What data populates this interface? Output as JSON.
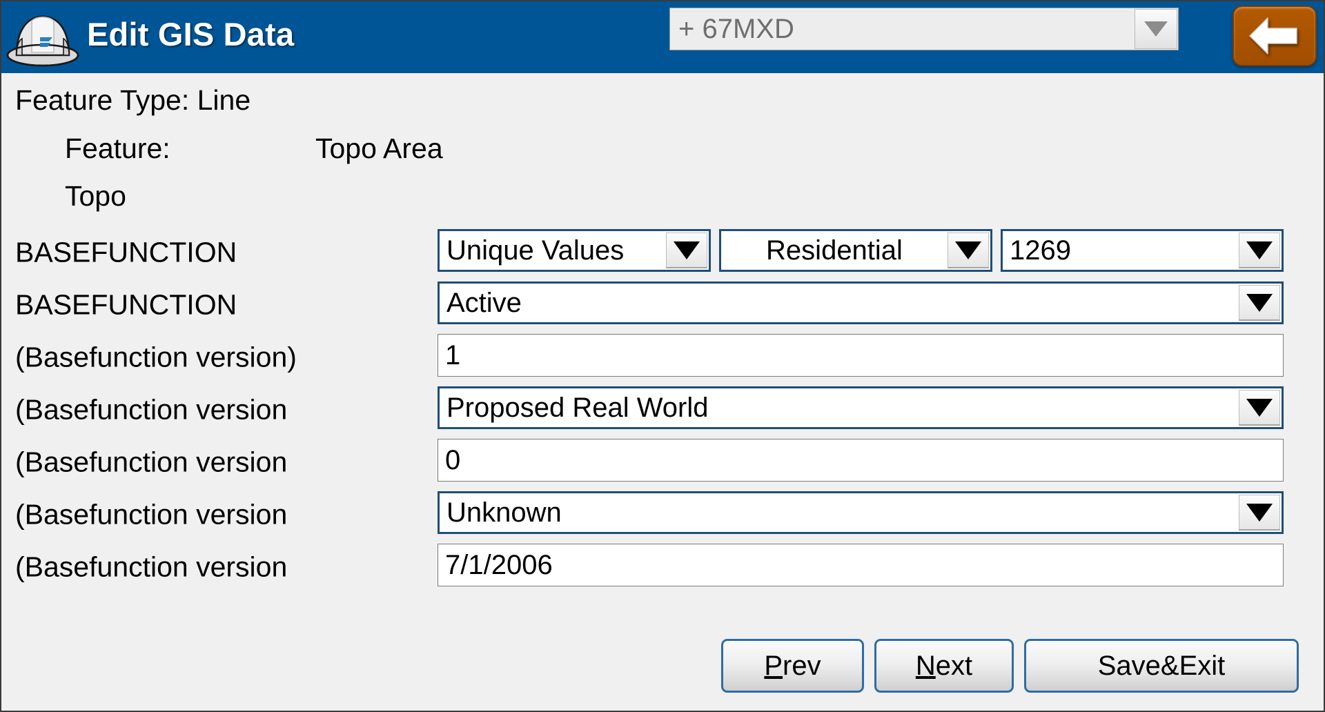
{
  "titlebar": {
    "app_title": "Edit GIS Data",
    "helmet_icon": "hard-hat-icon",
    "layer_combo": {
      "value": "+ 67MXD",
      "dropdown_icon": "chevron-down-icon"
    },
    "back_button": {
      "icon": "arrow-left-icon",
      "label": ""
    },
    "colors": {
      "header_blue": "#005596",
      "back_orange": "#b35900"
    }
  },
  "header_info": {
    "feature_type_line": "Feature Type: Line",
    "feature_label": "Feature:",
    "feature_value": "Topo Area",
    "topo_label": "Topo"
  },
  "form": {
    "rows": [
      {
        "label": "BASEFUNCTION",
        "kind": "triple-combo",
        "fields": [
          {
            "value": "Unique Values",
            "type": "combo"
          },
          {
            "value": "Residential",
            "type": "combo"
          },
          {
            "value": "1269",
            "type": "combo"
          }
        ]
      },
      {
        "label": "BASEFUNCTION",
        "kind": "combo",
        "fields": [
          {
            "value": "Active",
            "type": "combo"
          }
        ]
      },
      {
        "label": "(Basefunction version)",
        "kind": "text",
        "fields": [
          {
            "value": "1",
            "type": "text"
          }
        ]
      },
      {
        "label": "(Basefunction version",
        "kind": "combo",
        "fields": [
          {
            "value": "Proposed Real World",
            "type": "combo"
          }
        ]
      },
      {
        "label": "(Basefunction version",
        "kind": "text",
        "fields": [
          {
            "value": "0",
            "type": "text"
          }
        ]
      },
      {
        "label": "(Basefunction version",
        "kind": "combo",
        "fields": [
          {
            "value": "Unknown",
            "type": "combo"
          }
        ]
      },
      {
        "label": "(Basefunction version",
        "kind": "text",
        "fields": [
          {
            "value": "7/1/2006",
            "type": "text"
          }
        ]
      }
    ]
  },
  "footer": {
    "prev_accel": "P",
    "prev_rest": "rev",
    "next_accel": "N",
    "next_rest": "ext",
    "save_exit": "Save&Exit"
  }
}
